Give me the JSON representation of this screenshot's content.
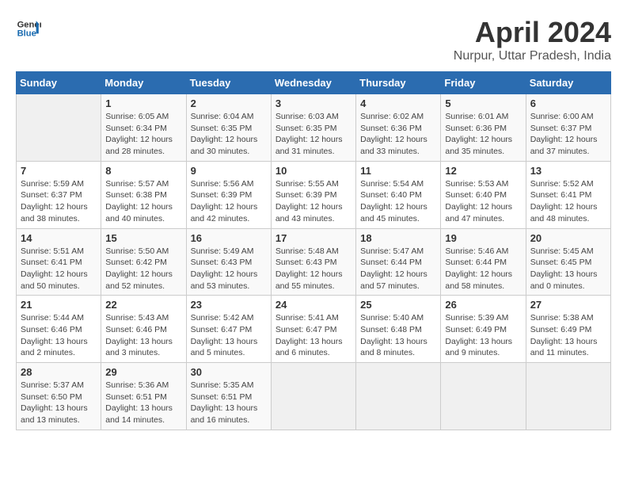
{
  "header": {
    "logo_line1": "General",
    "logo_line2": "Blue",
    "month": "April 2024",
    "location": "Nurpur, Uttar Pradesh, India"
  },
  "days_of_week": [
    "Sunday",
    "Monday",
    "Tuesday",
    "Wednesday",
    "Thursday",
    "Friday",
    "Saturday"
  ],
  "weeks": [
    [
      {
        "day": "",
        "info": ""
      },
      {
        "day": "1",
        "info": "Sunrise: 6:05 AM\nSunset: 6:34 PM\nDaylight: 12 hours\nand 28 minutes."
      },
      {
        "day": "2",
        "info": "Sunrise: 6:04 AM\nSunset: 6:35 PM\nDaylight: 12 hours\nand 30 minutes."
      },
      {
        "day": "3",
        "info": "Sunrise: 6:03 AM\nSunset: 6:35 PM\nDaylight: 12 hours\nand 31 minutes."
      },
      {
        "day": "4",
        "info": "Sunrise: 6:02 AM\nSunset: 6:36 PM\nDaylight: 12 hours\nand 33 minutes."
      },
      {
        "day": "5",
        "info": "Sunrise: 6:01 AM\nSunset: 6:36 PM\nDaylight: 12 hours\nand 35 minutes."
      },
      {
        "day": "6",
        "info": "Sunrise: 6:00 AM\nSunset: 6:37 PM\nDaylight: 12 hours\nand 37 minutes."
      }
    ],
    [
      {
        "day": "7",
        "info": "Sunrise: 5:59 AM\nSunset: 6:37 PM\nDaylight: 12 hours\nand 38 minutes."
      },
      {
        "day": "8",
        "info": "Sunrise: 5:57 AM\nSunset: 6:38 PM\nDaylight: 12 hours\nand 40 minutes."
      },
      {
        "day": "9",
        "info": "Sunrise: 5:56 AM\nSunset: 6:39 PM\nDaylight: 12 hours\nand 42 minutes."
      },
      {
        "day": "10",
        "info": "Sunrise: 5:55 AM\nSunset: 6:39 PM\nDaylight: 12 hours\nand 43 minutes."
      },
      {
        "day": "11",
        "info": "Sunrise: 5:54 AM\nSunset: 6:40 PM\nDaylight: 12 hours\nand 45 minutes."
      },
      {
        "day": "12",
        "info": "Sunrise: 5:53 AM\nSunset: 6:40 PM\nDaylight: 12 hours\nand 47 minutes."
      },
      {
        "day": "13",
        "info": "Sunrise: 5:52 AM\nSunset: 6:41 PM\nDaylight: 12 hours\nand 48 minutes."
      }
    ],
    [
      {
        "day": "14",
        "info": "Sunrise: 5:51 AM\nSunset: 6:41 PM\nDaylight: 12 hours\nand 50 minutes."
      },
      {
        "day": "15",
        "info": "Sunrise: 5:50 AM\nSunset: 6:42 PM\nDaylight: 12 hours\nand 52 minutes."
      },
      {
        "day": "16",
        "info": "Sunrise: 5:49 AM\nSunset: 6:43 PM\nDaylight: 12 hours\nand 53 minutes."
      },
      {
        "day": "17",
        "info": "Sunrise: 5:48 AM\nSunset: 6:43 PM\nDaylight: 12 hours\nand 55 minutes."
      },
      {
        "day": "18",
        "info": "Sunrise: 5:47 AM\nSunset: 6:44 PM\nDaylight: 12 hours\nand 57 minutes."
      },
      {
        "day": "19",
        "info": "Sunrise: 5:46 AM\nSunset: 6:44 PM\nDaylight: 12 hours\nand 58 minutes."
      },
      {
        "day": "20",
        "info": "Sunrise: 5:45 AM\nSunset: 6:45 PM\nDaylight: 13 hours\nand 0 minutes."
      }
    ],
    [
      {
        "day": "21",
        "info": "Sunrise: 5:44 AM\nSunset: 6:46 PM\nDaylight: 13 hours\nand 2 minutes."
      },
      {
        "day": "22",
        "info": "Sunrise: 5:43 AM\nSunset: 6:46 PM\nDaylight: 13 hours\nand 3 minutes."
      },
      {
        "day": "23",
        "info": "Sunrise: 5:42 AM\nSunset: 6:47 PM\nDaylight: 13 hours\nand 5 minutes."
      },
      {
        "day": "24",
        "info": "Sunrise: 5:41 AM\nSunset: 6:47 PM\nDaylight: 13 hours\nand 6 minutes."
      },
      {
        "day": "25",
        "info": "Sunrise: 5:40 AM\nSunset: 6:48 PM\nDaylight: 13 hours\nand 8 minutes."
      },
      {
        "day": "26",
        "info": "Sunrise: 5:39 AM\nSunset: 6:49 PM\nDaylight: 13 hours\nand 9 minutes."
      },
      {
        "day": "27",
        "info": "Sunrise: 5:38 AM\nSunset: 6:49 PM\nDaylight: 13 hours\nand 11 minutes."
      }
    ],
    [
      {
        "day": "28",
        "info": "Sunrise: 5:37 AM\nSunset: 6:50 PM\nDaylight: 13 hours\nand 13 minutes."
      },
      {
        "day": "29",
        "info": "Sunrise: 5:36 AM\nSunset: 6:51 PM\nDaylight: 13 hours\nand 14 minutes."
      },
      {
        "day": "30",
        "info": "Sunrise: 5:35 AM\nSunset: 6:51 PM\nDaylight: 13 hours\nand 16 minutes."
      },
      {
        "day": "",
        "info": ""
      },
      {
        "day": "",
        "info": ""
      },
      {
        "day": "",
        "info": ""
      },
      {
        "day": "",
        "info": ""
      }
    ]
  ]
}
